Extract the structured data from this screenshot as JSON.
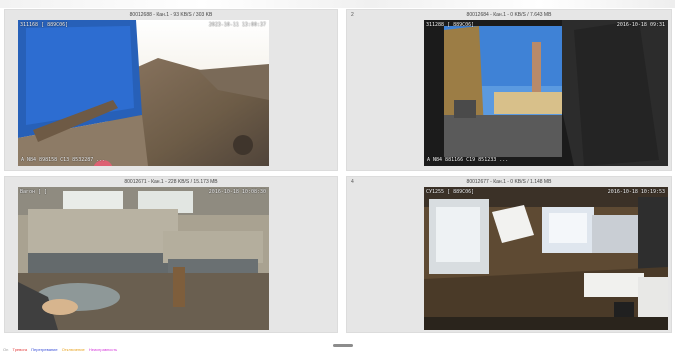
{
  "tiles": [
    {
      "num": "",
      "title": "80012688 - Кан.1 - 93 KB/S / 303 KB",
      "osd_tl": "311168 [ 889C06]",
      "osd_tr": "2023-10-11 13:00:37",
      "osd_bl": "A N84 898158 C13 8532287 ..."
    },
    {
      "num": "2",
      "title": "80012684 - Кан.1 - 0 KB/S / 7.643 MB",
      "osd_tl": "311288 [ 889C06]",
      "osd_tr": "2016-10-18 09:31",
      "osd_bl": "A N84 881166 C19 851233 ..."
    },
    {
      "num": "",
      "title": "80012671 - Кан.1 - 228 KB/S / 15.173 MB",
      "osd_tl": "Вагон [  ]",
      "osd_tr": "2016-10-18 10:08:30",
      "osd_bl": ""
    },
    {
      "num": "4",
      "title": "80012677 - Кан.1 - 0 KB/S / 1.148 MB",
      "osd_tl": "СУ1255 [ 889C06]",
      "osd_tr": "2016-10-18 10:19:53",
      "osd_bl": ""
    }
  ],
  "legend": [
    {
      "label": "On",
      "color": "#9a9a9a"
    },
    {
      "label": "Тревога",
      "color": "#e33b3b"
    },
    {
      "label": "Перегревание",
      "color": "#3a4fd8"
    },
    {
      "label": "Отключение",
      "color": "#e8a21c"
    },
    {
      "label": "Неисправность",
      "color": "#d63adb"
    }
  ],
  "colors": {
    "tile_bg": "#e6e6e6",
    "handle": "#8c8c8c"
  }
}
